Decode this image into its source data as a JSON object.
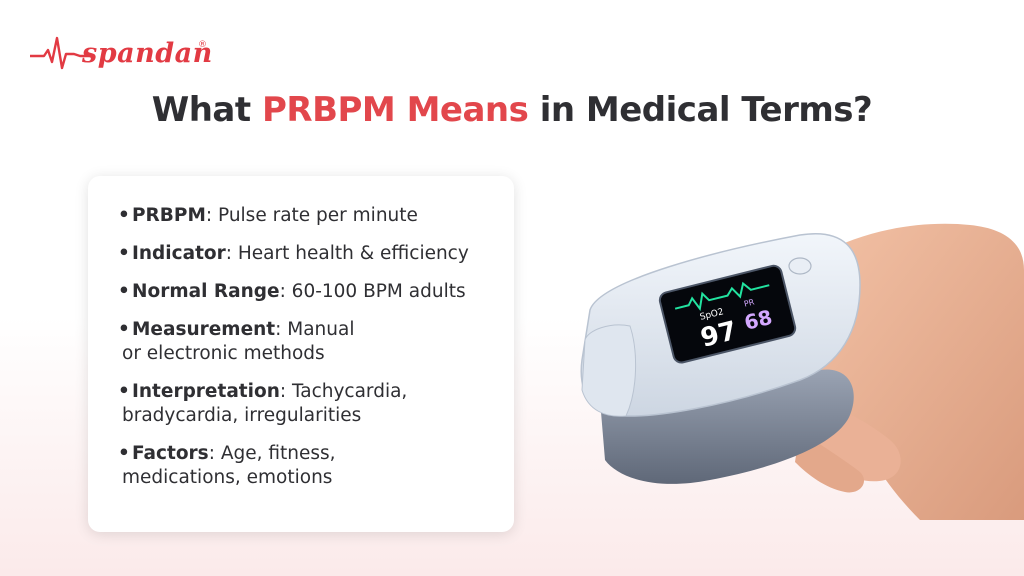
{
  "brand": {
    "name": "spandan",
    "registered": "®",
    "accent": "#e23a43"
  },
  "title": {
    "prefix": "What",
    "highlight": "PRBPM Means",
    "suffix": "in Medical Terms?",
    "highlight_color": "#e2474c"
  },
  "items": [
    {
      "label": "PRBPM",
      "text": ": Pulse rate per minute",
      "cont": ""
    },
    {
      "label": "Indicator",
      "text": ": Heart health & efficiency",
      "cont": ""
    },
    {
      "label": "Normal Range",
      "text": ": 60-100 BPM adults",
      "cont": ""
    },
    {
      "label": "Measurement",
      "text": ": Manual",
      "cont": "or electronic methods"
    },
    {
      "label": "Interpretation",
      "text": ": Tachycardia,",
      "cont": "bradycardia, irregularities"
    },
    {
      "label": "Factors",
      "text": ": Age, fitness,",
      "cont": "medications, emotions"
    }
  ],
  "oximeter": {
    "spo2_label": "SpO2",
    "spo2_value": "97",
    "pr_label": "PR",
    "pr_value": "68",
    "spo2_color": "#ffffff",
    "pr_color": "#d4a8ff",
    "wave_color": "#22e3a0"
  },
  "icons": [
    "heartbeat-line-icon",
    "pulse-oximeter-image",
    "hand-image"
  ]
}
